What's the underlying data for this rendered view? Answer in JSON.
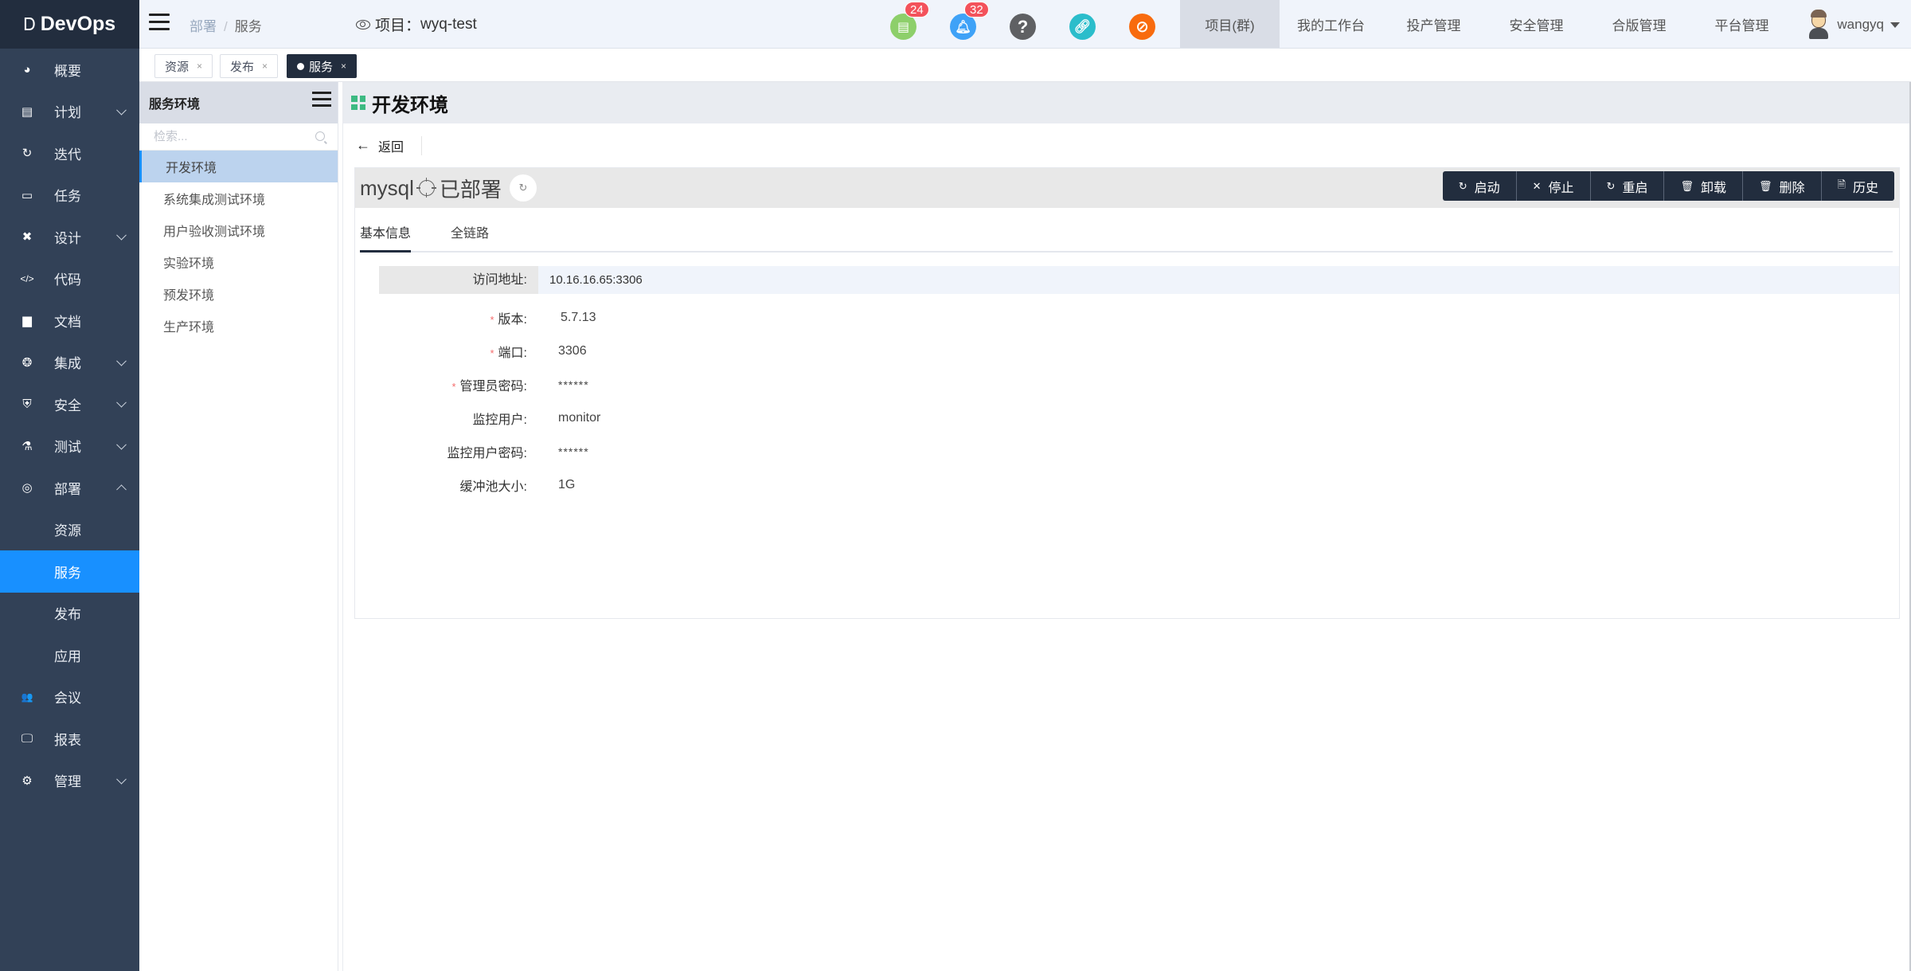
{
  "app": {
    "name": "DevOps"
  },
  "sidebar": {
    "items": [
      {
        "label": "概要",
        "icon": "dashboard-icon",
        "expandable": false
      },
      {
        "label": "计划",
        "icon": "plan-icon",
        "expandable": true
      },
      {
        "label": "迭代",
        "icon": "iteration-icon",
        "expandable": false
      },
      {
        "label": "任务",
        "icon": "task-icon",
        "expandable": false
      },
      {
        "label": "设计",
        "icon": "design-icon",
        "expandable": true
      },
      {
        "label": "代码",
        "icon": "code-icon",
        "expandable": false
      },
      {
        "label": "文档",
        "icon": "document-icon",
        "expandable": false
      },
      {
        "label": "集成",
        "icon": "integration-icon",
        "expandable": true
      },
      {
        "label": "安全",
        "icon": "shield-icon",
        "expandable": true
      },
      {
        "label": "测试",
        "icon": "flask-icon",
        "expandable": true
      },
      {
        "label": "部署",
        "icon": "deploy-icon",
        "expandable": true,
        "expanded": true
      },
      {
        "label": "资源",
        "sub": true
      },
      {
        "label": "服务",
        "sub": true,
        "active": true
      },
      {
        "label": "发布",
        "sub": true
      },
      {
        "label": "应用",
        "sub": true
      },
      {
        "label": "会议",
        "icon": "meeting-icon",
        "expandable": false
      },
      {
        "label": "报表",
        "icon": "report-icon",
        "expandable": false
      },
      {
        "label": "管理",
        "icon": "gear-icon",
        "expandable": true
      }
    ]
  },
  "header": {
    "breadcrumb": [
      "部署",
      "服务"
    ],
    "project_label": "项目：",
    "project_name": "wyq-test",
    "icons": [
      {
        "name": "todo-icon",
        "badge": "24",
        "color": "#8dcf6a"
      },
      {
        "name": "bell-icon",
        "badge": "32",
        "color": "#3fa2f7"
      },
      {
        "name": "help-icon",
        "badge": null,
        "color": "#5f6063"
      },
      {
        "name": "link-icon",
        "badge": null,
        "color": "#2bbdcb"
      },
      {
        "name": "no-bug-icon",
        "badge": null,
        "color": "#f86b0e"
      }
    ],
    "nav": [
      "项目(群)",
      "我的工作台",
      "投产管理",
      "安全管理",
      "合版管理",
      "平台管理"
    ],
    "nav_active": 0,
    "user": "wangyq"
  },
  "tags": [
    {
      "label": "资源",
      "active": false
    },
    {
      "label": "发布",
      "active": false
    },
    {
      "label": "服务",
      "active": true
    }
  ],
  "env_panel": {
    "title": "服务环境",
    "search_placeholder": "检索...",
    "items": [
      "开发环境",
      "系统集成测试环境",
      "用户验收测试环境",
      "实验环境",
      "预发环境",
      "生产环境"
    ],
    "active": 0
  },
  "main": {
    "title": "开发环境",
    "back_label": "返回",
    "service": {
      "name": "mysql",
      "status": "已部署",
      "actions": [
        {
          "label": "启动",
          "icon": "refresh-icon"
        },
        {
          "label": "停止",
          "icon": "close-icon"
        },
        {
          "label": "重启",
          "icon": "refresh-icon"
        },
        {
          "label": "卸载",
          "icon": "trash-icon"
        },
        {
          "label": "删除",
          "icon": "trash-icon"
        },
        {
          "label": "历史",
          "icon": "file-icon"
        }
      ]
    },
    "tabs": [
      "基本信息",
      "全链路"
    ],
    "active_tab": 0,
    "access": {
      "label": "访问地址:",
      "value": "10.16.16.65:3306"
    },
    "fields": [
      {
        "label": "版本:",
        "value": "5.7.13",
        "required": true
      },
      {
        "label": "端口:",
        "value": "3306",
        "required": true
      },
      {
        "label": "管理员密码:",
        "value": "******",
        "required": true,
        "password": true
      },
      {
        "label": "监控用户:",
        "value": "monitor",
        "required": false
      },
      {
        "label": "监控用户密码:",
        "value": "******",
        "required": false,
        "password": true
      },
      {
        "label": "缓冲池大小:",
        "value": "1G",
        "required": false
      }
    ]
  }
}
